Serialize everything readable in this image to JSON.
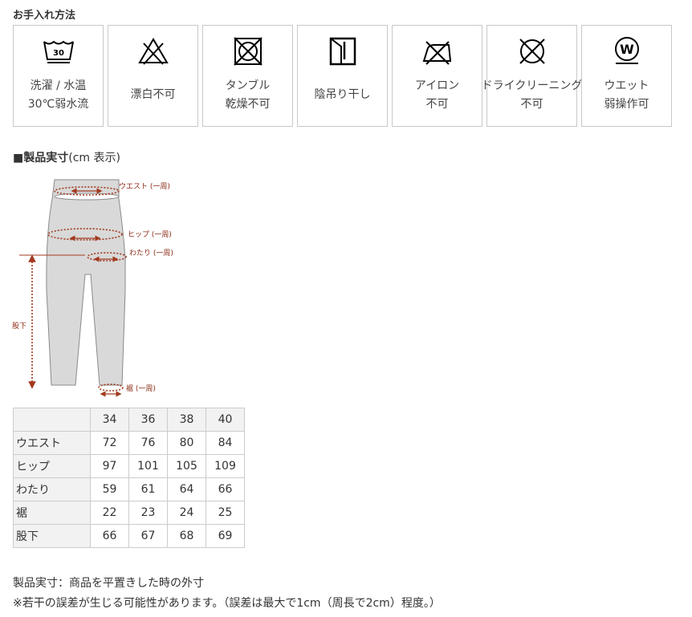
{
  "care": {
    "title": "お手入れ方法",
    "items": [
      {
        "icon": "wash-30-gentle-icon",
        "line1": "洗濯 / 水温",
        "line2": "30℃弱水流"
      },
      {
        "icon": "no-bleach-icon",
        "line1": "漂白不可",
        "line2": ""
      },
      {
        "icon": "no-tumble-dry-icon",
        "line1": "タンブル",
        "line2": "乾燥不可"
      },
      {
        "icon": "line-dry-shade-icon",
        "line1": "陰吊り干し",
        "line2": ""
      },
      {
        "icon": "no-iron-icon",
        "line1": "アイロン",
        "line2": "不可"
      },
      {
        "icon": "no-dry-clean-icon",
        "line1": "ドライクリーニング",
        "line2": "不可"
      },
      {
        "icon": "wet-clean-gentle-icon",
        "line1": "ウエット",
        "line2": "弱操作可"
      }
    ],
    "wash_temp": "30",
    "wet_letter": "W"
  },
  "size_section": {
    "title_bold": "■製品実寸",
    "title_rest": "(cm 表示)"
  },
  "diagram": {
    "labels": {
      "waist": "ウエスト (一周)",
      "hip": "ヒップ (一周)",
      "thigh": "わたり (一周)",
      "inseam": "股下",
      "hem": "裾 (一周)"
    },
    "accent_color": "#a23a1e",
    "garment_color": "#d9d9d9"
  },
  "table": {
    "sizes": [
      "34",
      "36",
      "38",
      "40"
    ],
    "rows": [
      {
        "label": "ウエスト",
        "values": [
          "72",
          "76",
          "80",
          "84"
        ]
      },
      {
        "label": "ヒップ",
        "values": [
          "97",
          "101",
          "105",
          "109"
        ]
      },
      {
        "label": "わたり",
        "values": [
          "59",
          "61",
          "64",
          "66"
        ]
      },
      {
        "label": "裾",
        "values": [
          "22",
          "23",
          "24",
          "25"
        ]
      },
      {
        "label": "股下",
        "values": [
          "66",
          "67",
          "68",
          "69"
        ]
      }
    ]
  },
  "notes": {
    "line1": "製品実寸：商品を平置きした時の外寸",
    "line2": "※若干の誤差が生じる可能性があります。（誤差は最大で1cm（周長で2cm）程度。）"
  }
}
